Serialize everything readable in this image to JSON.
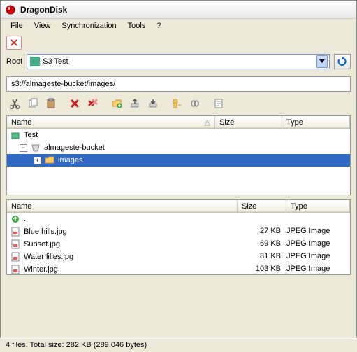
{
  "window": {
    "title": "DragonDisk"
  },
  "menu": {
    "file": "File",
    "view": "View",
    "sync": "Synchronization",
    "tools": "Tools",
    "help": "?"
  },
  "root": {
    "label": "Root",
    "value": "S3 Test"
  },
  "address": {
    "url": "s3://almageste-bucket/images/"
  },
  "tree": {
    "cols": {
      "name": "Name",
      "size": "Size",
      "type": "Type"
    },
    "root": "Test",
    "bucket": "almageste-bucket",
    "folder": "images"
  },
  "files": {
    "cols": {
      "name": "Name",
      "size": "Size",
      "type": "Type"
    },
    "up": "..",
    "items": [
      {
        "name": "Blue hills.jpg",
        "size": "27 KB",
        "type": "JPEG Image"
      },
      {
        "name": "Sunset.jpg",
        "size": "69 KB",
        "type": "JPEG Image"
      },
      {
        "name": "Water lilies.jpg",
        "size": "81 KB",
        "type": "JPEG Image"
      },
      {
        "name": "Winter.jpg",
        "size": "103 KB",
        "type": "JPEG Image"
      }
    ]
  },
  "status": {
    "text": "4 files. Total size: 282 KB (289,046 bytes)"
  }
}
